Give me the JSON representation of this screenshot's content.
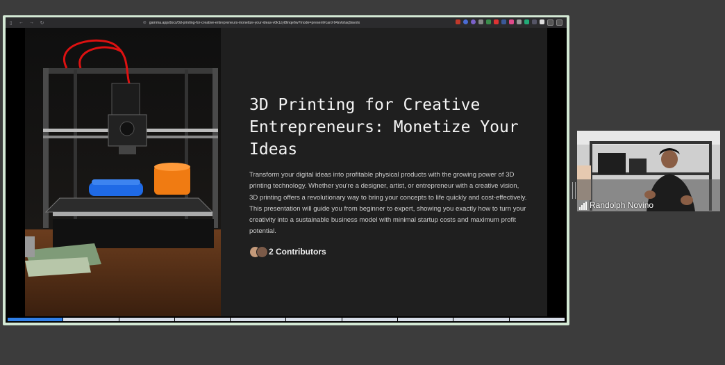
{
  "browser": {
    "url": "gamma.app/docs/3d-printing-for-creative-entrepreneurs-monetize-your-ideas-v0k1zyt8inqe6w?mode=present#card-94zvkrtaq9avotx"
  },
  "slide": {
    "title": "3D Printing for Creative Entrepreneurs: Monetize Your Ideas",
    "body": "Transform your digital ideas into profitable physical products with the growing power of 3D printing technology. Whether you're a designer, artist, or entrepreneur with a creative vision, 3D printing offers a revolutionary way to bring your concepts to life quickly and cost-effectively. This presentation will guide you from beginner to expert, showing you exactly how to turn your creativity into a sustainable business model with minimal startup costs and maximum profit potential.",
    "contributors_label": "2 Contributors",
    "image_icon": "3d-printer-photo"
  },
  "progress": {
    "total_segments": 10,
    "current_segment": 1
  },
  "webcam": {
    "participant_name": "Randolph Novino"
  },
  "colors": {
    "slide_bg": "#1f1f1f",
    "progress_active": "#2f7ee6",
    "progress_inactive": "#d7dde8",
    "frame_border": "#d3e8d4"
  }
}
